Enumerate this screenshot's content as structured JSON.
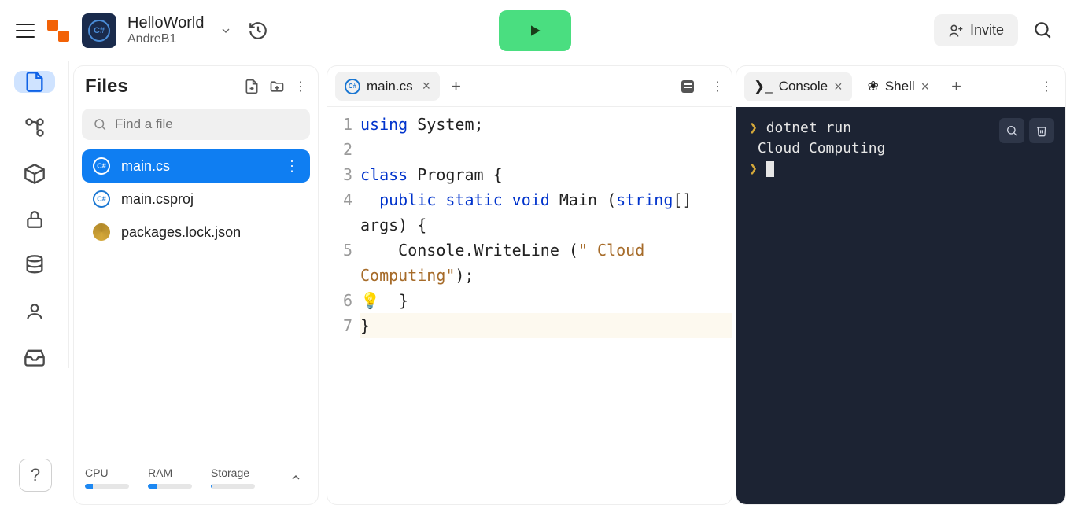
{
  "header": {
    "project_name": "HelloWorld",
    "owner": "AndreB1",
    "invite_label": "Invite"
  },
  "files_panel": {
    "title": "Files",
    "search_placeholder": "Find a file",
    "items": [
      {
        "name": "main.cs",
        "icon": "cs",
        "active": true
      },
      {
        "name": "main.csproj",
        "icon": "cs",
        "active": false
      },
      {
        "name": "packages.lock.json",
        "icon": "json",
        "active": false
      }
    ],
    "stats": {
      "cpu": {
        "label": "CPU",
        "pct": 18
      },
      "ram": {
        "label": "RAM",
        "pct": 22
      },
      "storage": {
        "label": "Storage",
        "pct": 2
      }
    }
  },
  "editor": {
    "tab_label": "main.cs",
    "lines": [
      "1",
      "2",
      "3",
      "4",
      "5",
      "6",
      "7"
    ],
    "code": {
      "l1_kw": "using",
      "l1_rest": " System;",
      "l3_kw": "class",
      "l3_rest": " Program {",
      "l4_pre": "  ",
      "l4_kw": "public static void",
      "l4_mid": " Main (",
      "l4_kw2": "string",
      "l4_end": "[] args) {",
      "l5_pre": "    Console.WriteLine (",
      "l5_str": "\" Cloud Computing\"",
      "l5_end": ");",
      "l6": "  }",
      "l7": "}"
    }
  },
  "terminal": {
    "tabs": {
      "console": "Console",
      "shell": "Shell"
    },
    "command": "dotnet run",
    "output": "Cloud Computing"
  }
}
